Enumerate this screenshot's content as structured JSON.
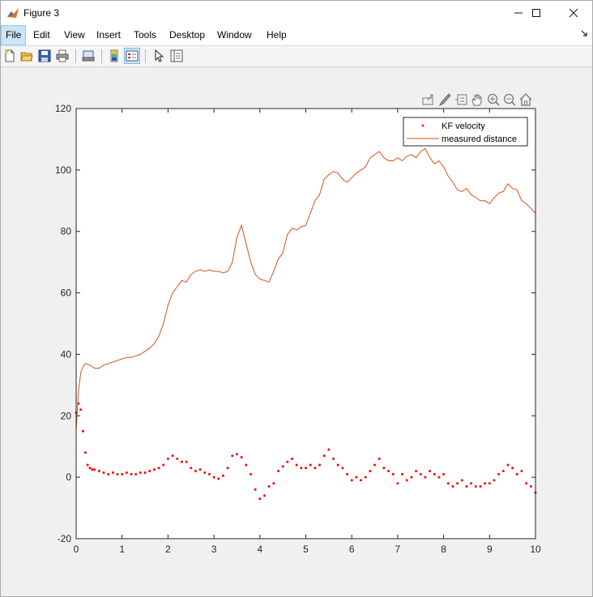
{
  "window": {
    "title": "Figure 3",
    "buttons": [
      "minimize",
      "maximize",
      "close"
    ]
  },
  "menubar": {
    "items": [
      "File",
      "Edit",
      "View",
      "Insert",
      "Tools",
      "Desktop",
      "Window",
      "Help"
    ],
    "active": "File"
  },
  "toolbar": {
    "buttons": [
      "new-figure-icon",
      "open-file-icon",
      "save-icon",
      "print-icon",
      "print-preview-icon",
      "colorbar-icon",
      "legend-icon",
      "pointer-icon",
      "property-inspector-icon"
    ]
  },
  "axes_toolbar": {
    "buttons": [
      "export-icon",
      "brush-icon",
      "data-tip-icon",
      "pan-icon",
      "zoom-in-icon",
      "zoom-out-icon",
      "home-icon"
    ]
  },
  "chart_data": {
    "type": "line",
    "xlim": [
      0,
      10
    ],
    "ylim": [
      -20,
      120
    ],
    "xticks": [
      "0",
      "1",
      "2",
      "3",
      "4",
      "5",
      "6",
      "7",
      "8",
      "9",
      "10"
    ],
    "yticks": [
      "-20",
      "0",
      "20",
      "40",
      "60",
      "80",
      "100",
      "120"
    ],
    "grid": false,
    "legend_position": "top-right",
    "colors": {
      "kf_velocity": "#ff0000",
      "measured_distance": "#d95319"
    },
    "series": [
      {
        "name": "KF velocity",
        "style": "dots",
        "x": [
          0.0,
          0.05,
          0.1,
          0.15,
          0.2,
          0.25,
          0.3,
          0.35,
          0.4,
          0.5,
          0.6,
          0.7,
          0.8,
          0.9,
          1.0,
          1.1,
          1.2,
          1.3,
          1.4,
          1.5,
          1.6,
          1.7,
          1.8,
          1.9,
          2.0,
          2.1,
          2.2,
          2.3,
          2.4,
          2.5,
          2.6,
          2.7,
          2.8,
          2.9,
          3.0,
          3.1,
          3.2,
          3.3,
          3.4,
          3.5,
          3.6,
          3.7,
          3.8,
          3.9,
          4.0,
          4.1,
          4.2,
          4.3,
          4.4,
          4.5,
          4.6,
          4.7,
          4.8,
          4.9,
          5.0,
          5.1,
          5.2,
          5.3,
          5.4,
          5.5,
          5.6,
          5.7,
          5.8,
          5.9,
          6.0,
          6.1,
          6.2,
          6.3,
          6.4,
          6.5,
          6.6,
          6.7,
          6.8,
          6.9,
          7.0,
          7.1,
          7.2,
          7.3,
          7.4,
          7.5,
          7.6,
          7.7,
          7.8,
          7.9,
          8.0,
          8.1,
          8.2,
          8.3,
          8.4,
          8.5,
          8.6,
          8.7,
          8.8,
          8.9,
          9.0,
          9.1,
          9.2,
          9.3,
          9.4,
          9.5,
          9.6,
          9.7,
          9.8,
          9.9,
          10.0
        ],
        "y": [
          21,
          24,
          22,
          15,
          8,
          4,
          3,
          2.5,
          2.5,
          2,
          1.5,
          1,
          1.5,
          1,
          1,
          1.5,
          1,
          1,
          1.5,
          1.5,
          2,
          2.5,
          3,
          4,
          6,
          7,
          6,
          5,
          5,
          3,
          2,
          2.5,
          1.5,
          1,
          0,
          -0.5,
          0.5,
          3,
          7,
          7.5,
          6.5,
          4,
          1,
          -4,
          -7,
          -6,
          -3,
          -2,
          2,
          3.5,
          5,
          6,
          4,
          3,
          3,
          4,
          3,
          4,
          7,
          9,
          6,
          4,
          3,
          1,
          -1,
          0,
          -1,
          0,
          2,
          4,
          6,
          3,
          2,
          1,
          -2,
          1,
          -1,
          0,
          2,
          1,
          0,
          2,
          1,
          0,
          1,
          -2,
          -3,
          -2,
          -1,
          -3,
          -2,
          -3,
          -3,
          -2,
          -2,
          -1,
          1,
          2,
          4,
          3,
          1,
          2,
          -2,
          -3,
          -5
        ]
      },
      {
        "name": "measured distance",
        "style": "line",
        "x": [
          0.0,
          0.05,
          0.1,
          0.15,
          0.2,
          0.3,
          0.4,
          0.5,
          0.6,
          0.7,
          0.8,
          0.9,
          1.0,
          1.1,
          1.2,
          1.3,
          1.4,
          1.5,
          1.6,
          1.7,
          1.8,
          1.9,
          2.0,
          2.1,
          2.2,
          2.3,
          2.4,
          2.5,
          2.6,
          2.7,
          2.8,
          2.9,
          3.0,
          3.1,
          3.2,
          3.3,
          3.4,
          3.5,
          3.6,
          3.7,
          3.8,
          3.9,
          4.0,
          4.1,
          4.2,
          4.3,
          4.4,
          4.5,
          4.6,
          4.7,
          4.8,
          4.9,
          5.0,
          5.1,
          5.2,
          5.3,
          5.4,
          5.5,
          5.6,
          5.7,
          5.8,
          5.9,
          6.0,
          6.1,
          6.2,
          6.3,
          6.4,
          6.5,
          6.6,
          6.7,
          6.8,
          6.9,
          7.0,
          7.1,
          7.2,
          7.3,
          7.4,
          7.5,
          7.6,
          7.7,
          7.8,
          7.9,
          8.0,
          8.1,
          8.2,
          8.3,
          8.4,
          8.5,
          8.6,
          8.7,
          8.8,
          8.9,
          9.0,
          9.1,
          9.2,
          9.3,
          9.4,
          9.5,
          9.6,
          9.7,
          9.8,
          9.9,
          10.0
        ],
        "y": [
          15,
          28,
          34,
          36,
          37,
          36.5,
          35.5,
          35.5,
          36.5,
          37,
          37.5,
          38,
          38.5,
          39,
          39,
          39.5,
          40,
          41,
          42,
          43.5,
          46,
          50,
          56,
          60,
          62,
          64,
          63.5,
          66,
          67,
          67.5,
          67,
          67.5,
          67,
          67,
          66.5,
          67,
          70,
          78,
          82,
          76,
          70,
          66,
          64.5,
          64,
          63.5,
          67,
          71,
          73,
          79,
          81,
          80.5,
          81.5,
          82,
          86,
          90,
          92,
          97,
          98.5,
          99.5,
          99,
          97,
          96,
          97.5,
          99,
          100,
          101,
          104,
          105,
          106,
          104,
          103,
          103,
          104,
          103,
          104.5,
          105,
          104,
          106,
          107,
          104,
          102,
          103,
          101,
          98,
          96,
          93.5,
          93,
          94,
          92,
          91,
          90,
          90,
          89,
          91,
          92.5,
          93,
          95.5,
          94,
          93.5,
          90,
          89,
          87.5,
          86
        ]
      }
    ]
  }
}
